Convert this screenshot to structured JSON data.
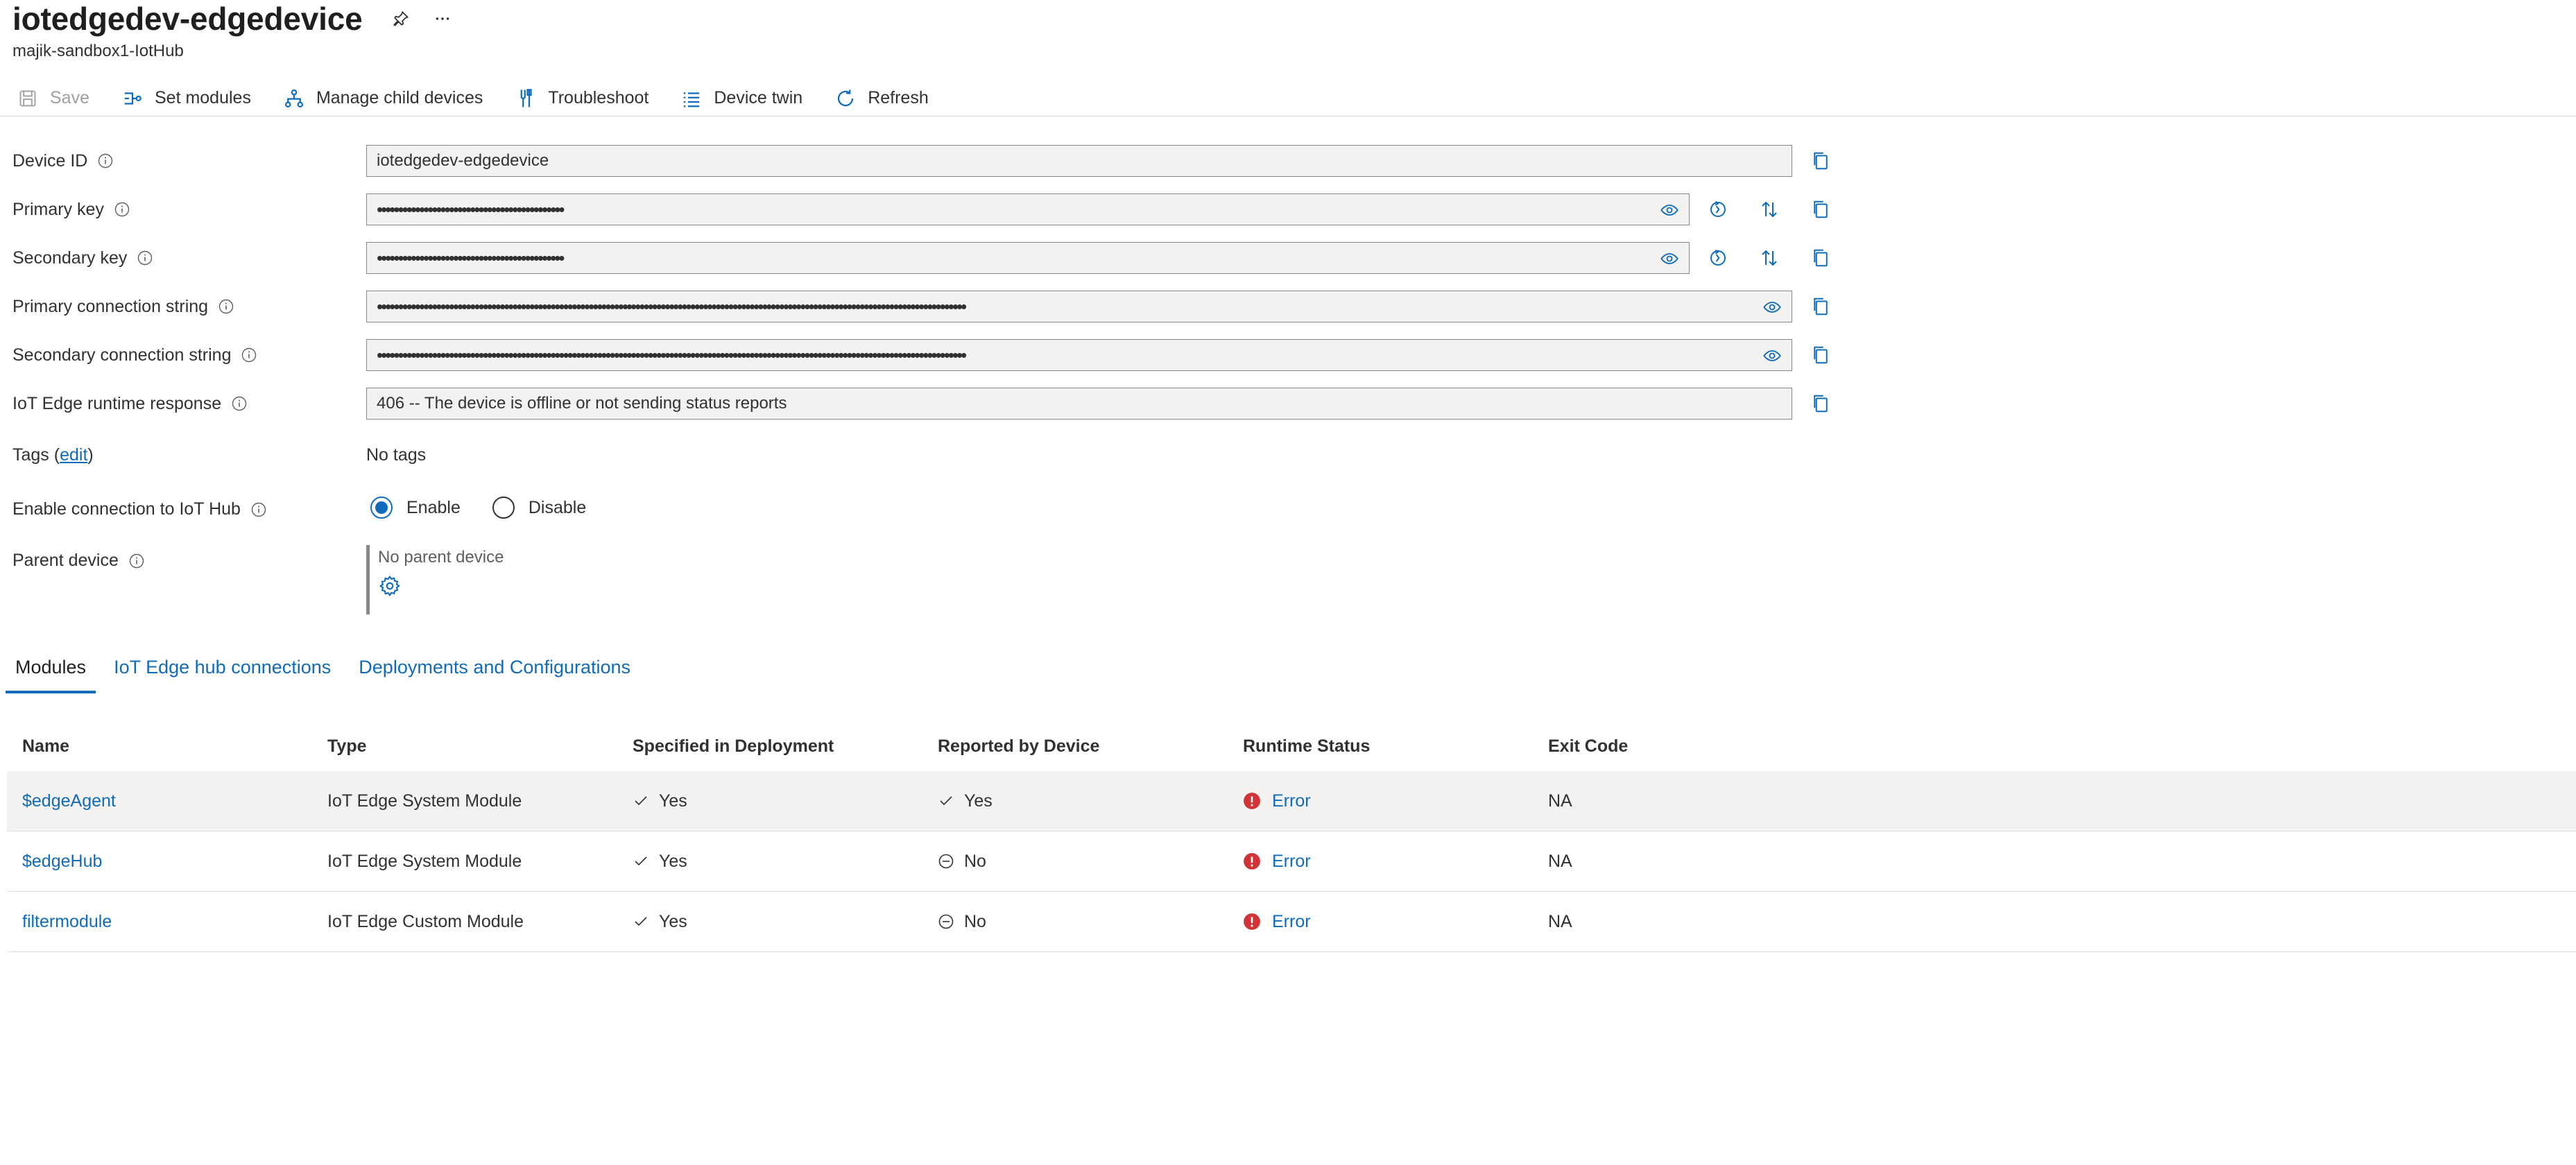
{
  "header": {
    "title": "iotedgedev-edgedevice",
    "subtitle": "majik-sandbox1-IotHub"
  },
  "toolbar": {
    "save": "Save",
    "set_modules": "Set modules",
    "manage_child": "Manage child devices",
    "troubleshoot": "Troubleshoot",
    "device_twin": "Device twin",
    "refresh": "Refresh"
  },
  "form": {
    "device_id": {
      "label": "Device ID",
      "value": "iotedgedev-edgedevice"
    },
    "primary_key": {
      "label": "Primary key",
      "value": "••••••••••••••••••••••••••••••••••••••••••••"
    },
    "secondary_key": {
      "label": "Secondary key",
      "value": "••••••••••••••••••••••••••••••••••••••••••••"
    },
    "primary_conn": {
      "label": "Primary connection string",
      "value": "•••••••••••••••••••••••••••••••••••••••••••••••••••••••••••••••••••••••••••••••••••••••••••••••••••••••••••••••••••••••••••••••••••••••••••"
    },
    "secondary_conn": {
      "label": "Secondary connection string",
      "value": "•••••••••••••••••••••••••••••••••••••••••••••••••••••••••••••••••••••••••••••••••••••••••••••••••••••••••••••••••••••••••••••••••••••••••••"
    },
    "runtime": {
      "label": "IoT Edge runtime response",
      "value": "406 -- The device is offline or not sending status reports"
    },
    "tags": {
      "label_prefix": "Tags (",
      "edit": "edit",
      "label_suffix": ")",
      "value": "No tags"
    },
    "enable": {
      "label": "Enable connection to IoT Hub",
      "enable": "Enable",
      "disable": "Disable"
    },
    "parent": {
      "label": "Parent device",
      "value": "No parent device"
    }
  },
  "tabs": [
    "Modules",
    "IoT Edge hub connections",
    "Deployments and Configurations"
  ],
  "table": {
    "headers": [
      "Name",
      "Type",
      "Specified in Deployment",
      "Reported by Device",
      "Runtime Status",
      "Exit Code"
    ],
    "rows": [
      {
        "name": "$edgeAgent",
        "type": "IoT Edge System Module",
        "specified": "Yes",
        "reported": "Yes",
        "status": "Error",
        "exit": "NA"
      },
      {
        "name": "$edgeHub",
        "type": "IoT Edge System Module",
        "specified": "Yes",
        "reported": "No",
        "status": "Error",
        "exit": "NA"
      },
      {
        "name": "filtermodule",
        "type": "IoT Edge Custom Module",
        "specified": "Yes",
        "reported": "No",
        "status": "Error",
        "exit": "NA"
      }
    ]
  },
  "colors": {
    "accent": "#0f6cbd",
    "error": "#d13438",
    "text": "#323130"
  },
  "icons": [
    "pin-icon",
    "more-icon",
    "save-icon",
    "set-modules-icon",
    "hierarchy-icon",
    "troubleshoot-icon",
    "list-icon",
    "refresh-icon",
    "info-icon",
    "copy-icon",
    "eye-icon",
    "regenerate-icon",
    "swap-icon",
    "gear-icon",
    "check-icon",
    "no-icon",
    "error-icon"
  ]
}
